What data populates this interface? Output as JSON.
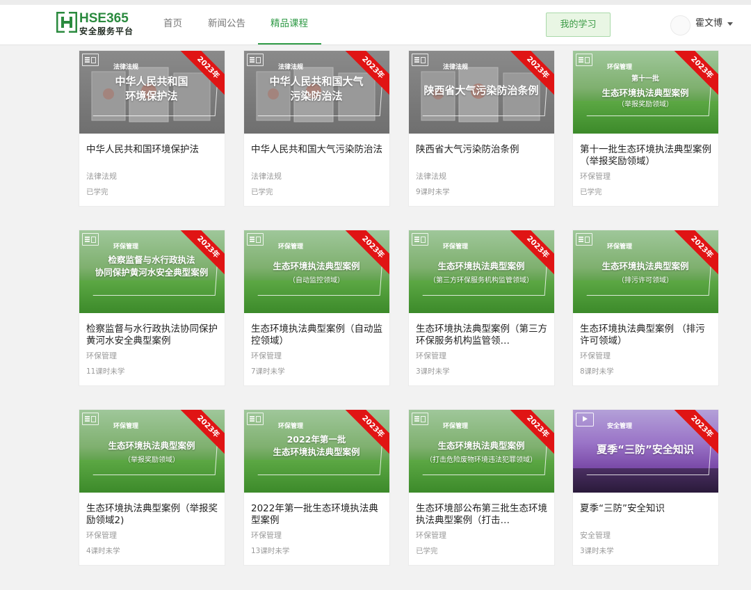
{
  "header": {
    "logo_text": "HSE365",
    "logo_sub": "安全服务平台",
    "nav": [
      {
        "label": "首页",
        "active": false
      },
      {
        "label": "新闻公告",
        "active": false
      },
      {
        "label": "精品课程",
        "active": true
      }
    ],
    "my_study_label": "我的学习",
    "username": "霍文博",
    "accent_color": "#2f9a46"
  },
  "ribbon_color": "#e01414",
  "courses": [
    {
      "thumb_style": "gray",
      "thumb_icon": "document-icon",
      "thumb_category": "法律法规",
      "thumb_lines": [
        "中华人民共和国",
        "环境保护法"
      ],
      "thumb_sub": "",
      "ribbon": "2023年",
      "title": "中华人民共和国环境保护法",
      "category": "法律法规",
      "status": "已学完"
    },
    {
      "thumb_style": "gray",
      "thumb_icon": "document-icon",
      "thumb_category": "法律法规",
      "thumb_lines": [
        "中华人民共和国大气",
        "污染防治法"
      ],
      "thumb_sub": "",
      "ribbon": "2023年",
      "title": "中华人民共和国大气污染防治法",
      "category": "法律法规",
      "status": "已学完"
    },
    {
      "thumb_style": "gray",
      "thumb_icon": "document-icon",
      "thumb_category": "法律法规",
      "thumb_lines": [
        "陕西省大气污染防治条例"
      ],
      "thumb_sub": "",
      "ribbon": "2023年",
      "title": "陕西省大气污染防治条例",
      "category": "法律法规",
      "status": "9课时未学"
    },
    {
      "thumb_style": "green",
      "thumb_icon": "document-icon",
      "thumb_category": "环保管理",
      "thumb_lines": [
        "第十一批",
        "生态环境执法典型案例"
      ],
      "thumb_sub": "（举报奖励领域）",
      "ribbon": "2023年",
      "title": "第十一批生态环境执法典型案例（举报奖励领域）",
      "category": "环保管理",
      "status": "已学完"
    },
    {
      "thumb_style": "green",
      "thumb_icon": "document-icon",
      "thumb_category": "环保管理",
      "thumb_lines": [
        "检察监督与水行政执法",
        "协同保护黄河水安全典型案例"
      ],
      "thumb_sub": "",
      "ribbon": "2023年",
      "title": "检察监督与水行政执法协同保护黄河水安全典型案例",
      "category": "环保管理",
      "status": "11课时未学"
    },
    {
      "thumb_style": "green",
      "thumb_icon": "document-icon",
      "thumb_category": "环保管理",
      "thumb_lines": [
        "生态环境执法典型案例"
      ],
      "thumb_sub": "（自动监控领域）",
      "ribbon": "2023年",
      "title": "生态环境执法典型案例（自动监控领域）",
      "category": "环保管理",
      "status": "7课时未学"
    },
    {
      "thumb_style": "green",
      "thumb_icon": "document-icon",
      "thumb_category": "环保管理",
      "thumb_lines": [
        "生态环境执法典型案例"
      ],
      "thumb_sub": "（第三方环保服务机构监管领域）",
      "ribbon": "2023年",
      "title": "生态环境执法典型案例（第三方环保服务机构监管领…",
      "category": "环保管理",
      "status": "3课时未学"
    },
    {
      "thumb_style": "green",
      "thumb_icon": "document-icon",
      "thumb_category": "环保管理",
      "thumb_lines": [
        "生态环境执法典型案例"
      ],
      "thumb_sub": "（排污许可领域）",
      "ribbon": "2023年",
      "title": "生态环境执法典型案例 （排污许可领域）",
      "category": "环保管理",
      "status": "8课时未学"
    },
    {
      "thumb_style": "green",
      "thumb_icon": "document-icon",
      "thumb_category": "环保管理",
      "thumb_lines": [
        "生态环境执法典型案例"
      ],
      "thumb_sub": "（举报奖励领域）",
      "ribbon": "2023年",
      "title": "生态环境执法典型案例（举报奖励领域2)",
      "category": "环保管理",
      "status": "4课时未学"
    },
    {
      "thumb_style": "green",
      "thumb_icon": "document-icon",
      "thumb_category": "环保管理",
      "thumb_lines": [
        "2022年第一批",
        "生态环境执法典型案例"
      ],
      "thumb_sub": "",
      "ribbon": "2023年",
      "title": "2022年第一批生态环境执法典型案例",
      "category": "环保管理",
      "status": "13课时未学"
    },
    {
      "thumb_style": "green",
      "thumb_icon": "document-icon",
      "thumb_category": "环保管理",
      "thumb_lines": [
        "生态环境执法典型案例"
      ],
      "thumb_sub": "（打击危险废物环境违法犯罪领域）",
      "ribbon": "2023年",
      "title": "生态环境部公布第三批生态环境执法典型案例（打击…",
      "category": "环保管理",
      "status": "已学完"
    },
    {
      "thumb_style": "purple",
      "thumb_icon": "video-icon",
      "thumb_category": "安全管理",
      "thumb_lines": [
        "夏季“三防”安全知识"
      ],
      "thumb_sub": "",
      "ribbon": "2023年",
      "title": "夏季“三防”安全知识",
      "category": "安全管理",
      "status": "3课时未学"
    }
  ]
}
